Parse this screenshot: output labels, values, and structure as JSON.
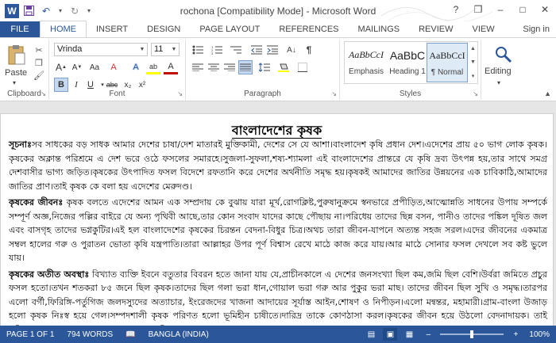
{
  "window": {
    "title": "rochona [Compatibility Mode] - Microsoft Word",
    "controls": {
      "help": "?",
      "restore": "❐",
      "minimize": "–",
      "maximize": "□",
      "close": "✕"
    }
  },
  "qat": {
    "save_icon": "save-icon",
    "undo_icon": "undo-icon",
    "redo_icon": "redo-icon"
  },
  "tabs": [
    {
      "label": "FILE"
    },
    {
      "label": "HOME"
    },
    {
      "label": "INSERT"
    },
    {
      "label": "DESIGN"
    },
    {
      "label": "PAGE LAYOUT"
    },
    {
      "label": "REFERENCES"
    },
    {
      "label": "MAILINGS"
    },
    {
      "label": "REVIEW"
    },
    {
      "label": "VIEW"
    }
  ],
  "signin": "Sign in",
  "clipboard": {
    "paste_label": "Paste",
    "group_label": "Clipboard"
  },
  "font": {
    "name": "Vrinda",
    "size": "11",
    "group_label": "Font",
    "bold": "B",
    "italic": "I",
    "underline": "U",
    "strike": "abc",
    "subscript": "x₂",
    "superscript": "x²",
    "grow": "A",
    "shrink": "A",
    "case": "Aa",
    "clear": "A",
    "effects": "A",
    "highlight": "ab",
    "color": "A"
  },
  "paragraph": {
    "group_label": "Paragraph"
  },
  "styles": {
    "group_label": "Styles",
    "items": [
      {
        "preview": "AaBbCcI",
        "name": "Emphasis"
      },
      {
        "preview": "AaBbC",
        "name": "Heading 1"
      },
      {
        "preview": "AaBbCcI",
        "name": "¶ Normal"
      }
    ]
  },
  "editing": {
    "label": "Editing"
  },
  "document": {
    "heading": "বাংলাদেশের কৃষক",
    "paragraphs": [
      {
        "lead": "সূচনাঃ",
        "text": "সব সাধকের বড় সাধক আমার দেশের চাষা/দেশ মাতারই মুক্তিকামী, দেশের সে যে আশা।বাংলাদেশ কৃষি প্রধান দেশ।এদেশের প্রায় ৫০ ভাগ লোক কৃষক।কৃষকের অক্লান্ত পরিশ্রমে এ দেশ ভরে ওঠে ফসলের সমারহে।সুজলা-সুফলা,শষ্য-শ্যামলা এই বাংলাদেশের প্রান্তরে যে কৃষি দ্রব্য উৎপন্ন হয়,তার সাথে সমগ্র দেশবাসীর ভাগ্য জড়িত।কৃষকের উৎপাদিত ফসল বিদেশে রফতানি করে দেশের অর্থনীতি সমৃদ্ধ হয়।কৃষকই আমাদের জাতির উন্নয়নের এক চাবিকাঠি,আমাদের জাতির প্রাণ।তাই কৃষক কে বলা হয় এদেশের মেরুদণ্ড।"
      },
      {
        "lead": "কৃষকের জীবনঃ",
        "text": " কৃষক বলতে এদেশের আমন এক সম্প্রদায় কে বুঝায় যারা মূর্খ,রোগক্লিষ্ট,পুরুষানুক্রমে স্বনভারে প্রপীড়িত,আত্মোন্নতি সাধনের উপায় সম্পর্কে সম্পূর্ণ অজ্ঞ,নিজের পল্লির বাইরে যে অন্য পৃথিবী আছে,তার কোন সংবাদ যাদের কাছে পৌছায় না।পরিধেয় তাদের ছিন্ন বসন, পানীও তাদের পঙ্কিল দূষিত জল এবং বাসগৃহ তাদের ভগ্নকুটির।এই হল বাংলাদেশের কৃষকের চিরন্তন বেদনা-বিধুর চিত্র।অথচ তারা জীবন-যাপনে অত্যন্ত সহজ সরল।এদের জীবনের একমাত্র সম্বল হালের গরু ও পুরাতন ভোতা কৃষি যন্ত্রপাতি।তারা আল্লাহর উপর পূর্ণ বিশ্বাস রেখে মাঠে কাজ করে যায়।আর মাঠে সোনার ফসল দেখলে সব কষ্ট ভুলে যায়।"
      },
      {
        "lead": "কৃষকের অতীত অবস্থাঃ",
        "text": " বিখ্যাত ব্যক্তি ইবনে বতুতার বিবরন হতে জানা যায় যে,প্রাচীনকালে এ দেশের জনসংখ্যা ছিল কম,জমি ছিল বেশি।উর্বরা জমিতে প্রচুর ফসল হতো।তখন শতকরা ৮৫ জনে ছিল কৃষক।তাদের ছিল গলা ভরা ধান,গোয়াল ভরা গরু আর পুকুর ভরা মাছ। তাদের জীবন ছিল সুখি ও সমৃদ্ধ।তারপর এলো বর্গী,ফিরিঙ্গি-পর্তুগিজ জলদস্যুদের অত্যাচার, ইংরেজদের খাজনা আদায়ের সূর্যাস্ত আইন,শোষণ ও নিপীড়ন।এলো মন্বন্তর, মহামারী।গ্রাম-বাংলা উজাড় হলো কৃষক নিঃস্ব হয়ে গেল।সম্পদশালী কৃষক পরিণত হলো ভূমিহীন চাষীতে।দারিদ্র তাকে কোণঠাসা করল।কৃষকের জীবন হয়ে উঠলো বেদনাদায়ক। তাই কবিগুরুর ভাষায়-স্বন্দে যত তার চাপে ভার/বহিচলে"
      }
    ]
  },
  "status": {
    "page": "PAGE 1 OF 1",
    "words": "794 WORDS",
    "language": "BANGLA (INDIA)",
    "zoom": "100%",
    "zoom_minus": "–",
    "zoom_plus": "+"
  }
}
